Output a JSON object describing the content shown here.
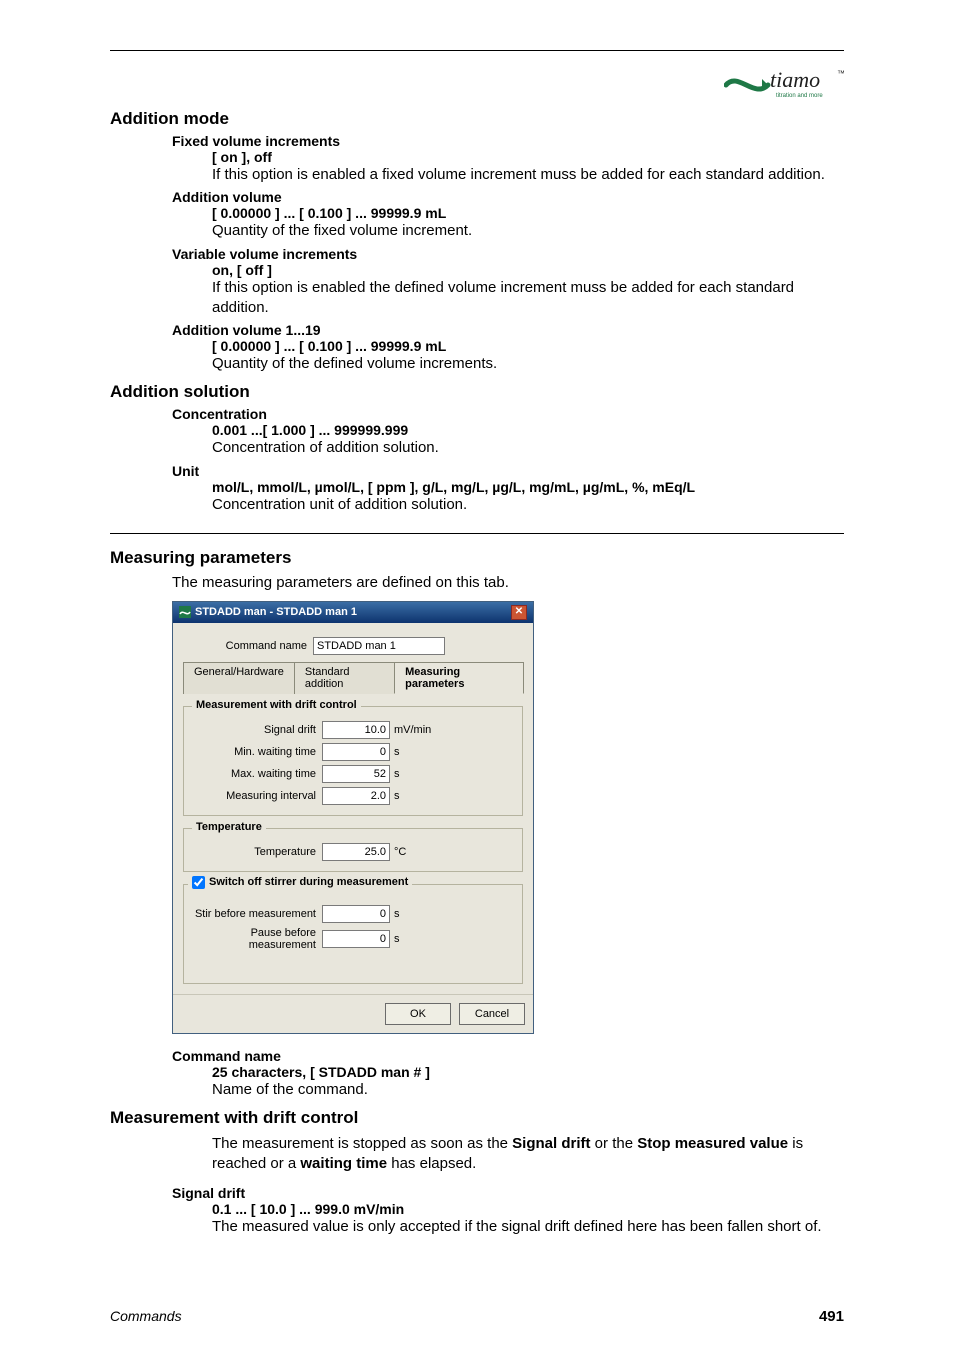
{
  "logo": {
    "brand": "tiamo",
    "tagline": "titration and more"
  },
  "sections": {
    "addition_mode": {
      "title": "Addition mode",
      "items": {
        "fvi": {
          "label": "Fixed volume increments",
          "range": "[ on ], off",
          "desc": "If this option is enabled a fixed volume increment muss be added for each standard addition."
        },
        "av": {
          "label": "Addition volume",
          "range": "[ 0.00000 ] ... [ 0.100 ] ... 99999.9 mL",
          "desc": "Quantity of the fixed volume increment."
        },
        "vvi": {
          "label": "Variable volume increments",
          "range": "on, [ off ]",
          "desc": "If this option is enabled the defined volume increment muss be added for each standard addition."
        },
        "av119": {
          "label": "Addition volume 1...19",
          "range": "[ 0.00000 ] ... [ 0.100 ] ... 99999.9 mL",
          "desc": "Quantity of the defined volume increments."
        }
      }
    },
    "addition_solution": {
      "title": "Addition solution",
      "items": {
        "conc": {
          "label": "Concentration",
          "range": "0.001 ...[ 1.000 ] ... 999999.999",
          "desc": "Concentration of addition solution."
        },
        "unit": {
          "label": "Unit",
          "range": "mol/L, mmol/L, µmol/L, [ ppm ], g/L, mg/L, µg/L, mg/mL, µg/mL, %, mEq/L",
          "desc": "Concentration unit of addition solution."
        }
      }
    },
    "measuring": {
      "title": "Measuring parameters",
      "intro": "The measuring parameters are defined on this tab."
    },
    "cmdname": {
      "label": "Command name",
      "range": "25 characters, [ STDADD man # ]",
      "desc": "Name of the command."
    },
    "mwdc": {
      "title": "Measurement with drift control",
      "intro_parts": {
        "t1": "The measurement is stopped as soon as the ",
        "b1": "Signal drift",
        "t2": " or the ",
        "b2": "Stop measured value",
        "t3": " is reached or a ",
        "b3": "waiting time",
        "t4": " has elapsed."
      },
      "items": {
        "sd": {
          "label": "Signal drift",
          "range": "0.1 ... [ 10.0 ] ... 999.0 mV/min",
          "desc": "The measured value is only accepted if the signal drift defined here has been fallen short of."
        }
      }
    }
  },
  "dialog": {
    "title": "STDADD man - STDADD man 1",
    "cmd_label": "Command name",
    "cmd_value": "STDADD man 1",
    "tabs": [
      "General/Hardware",
      "Standard addition",
      "Measuring parameters"
    ],
    "group1": {
      "title": "Measurement with drift control",
      "rows": {
        "sd": {
          "label": "Signal drift",
          "value": "10.0",
          "unit": "mV/min"
        },
        "min": {
          "label": "Min. waiting time",
          "value": "0",
          "unit": "s"
        },
        "max": {
          "label": "Max. waiting time",
          "value": "52",
          "unit": "s"
        },
        "mi": {
          "label": "Measuring interval",
          "value": "2.0",
          "unit": "s"
        }
      }
    },
    "group2": {
      "title": "Temperature",
      "rows": {
        "t": {
          "label": "Temperature",
          "value": "25.0",
          "unit": "°C"
        }
      }
    },
    "group3": {
      "title": "Switch off stirrer during measurement",
      "rows": {
        "stir": {
          "label": "Stir before measurement",
          "value": "0",
          "unit": "s"
        },
        "pause": {
          "label": "Pause before measurement",
          "value": "0",
          "unit": "s"
        }
      }
    },
    "buttons": {
      "ok": "OK",
      "cancel": "Cancel"
    }
  },
  "footer": {
    "section": "Commands",
    "page": "491"
  }
}
